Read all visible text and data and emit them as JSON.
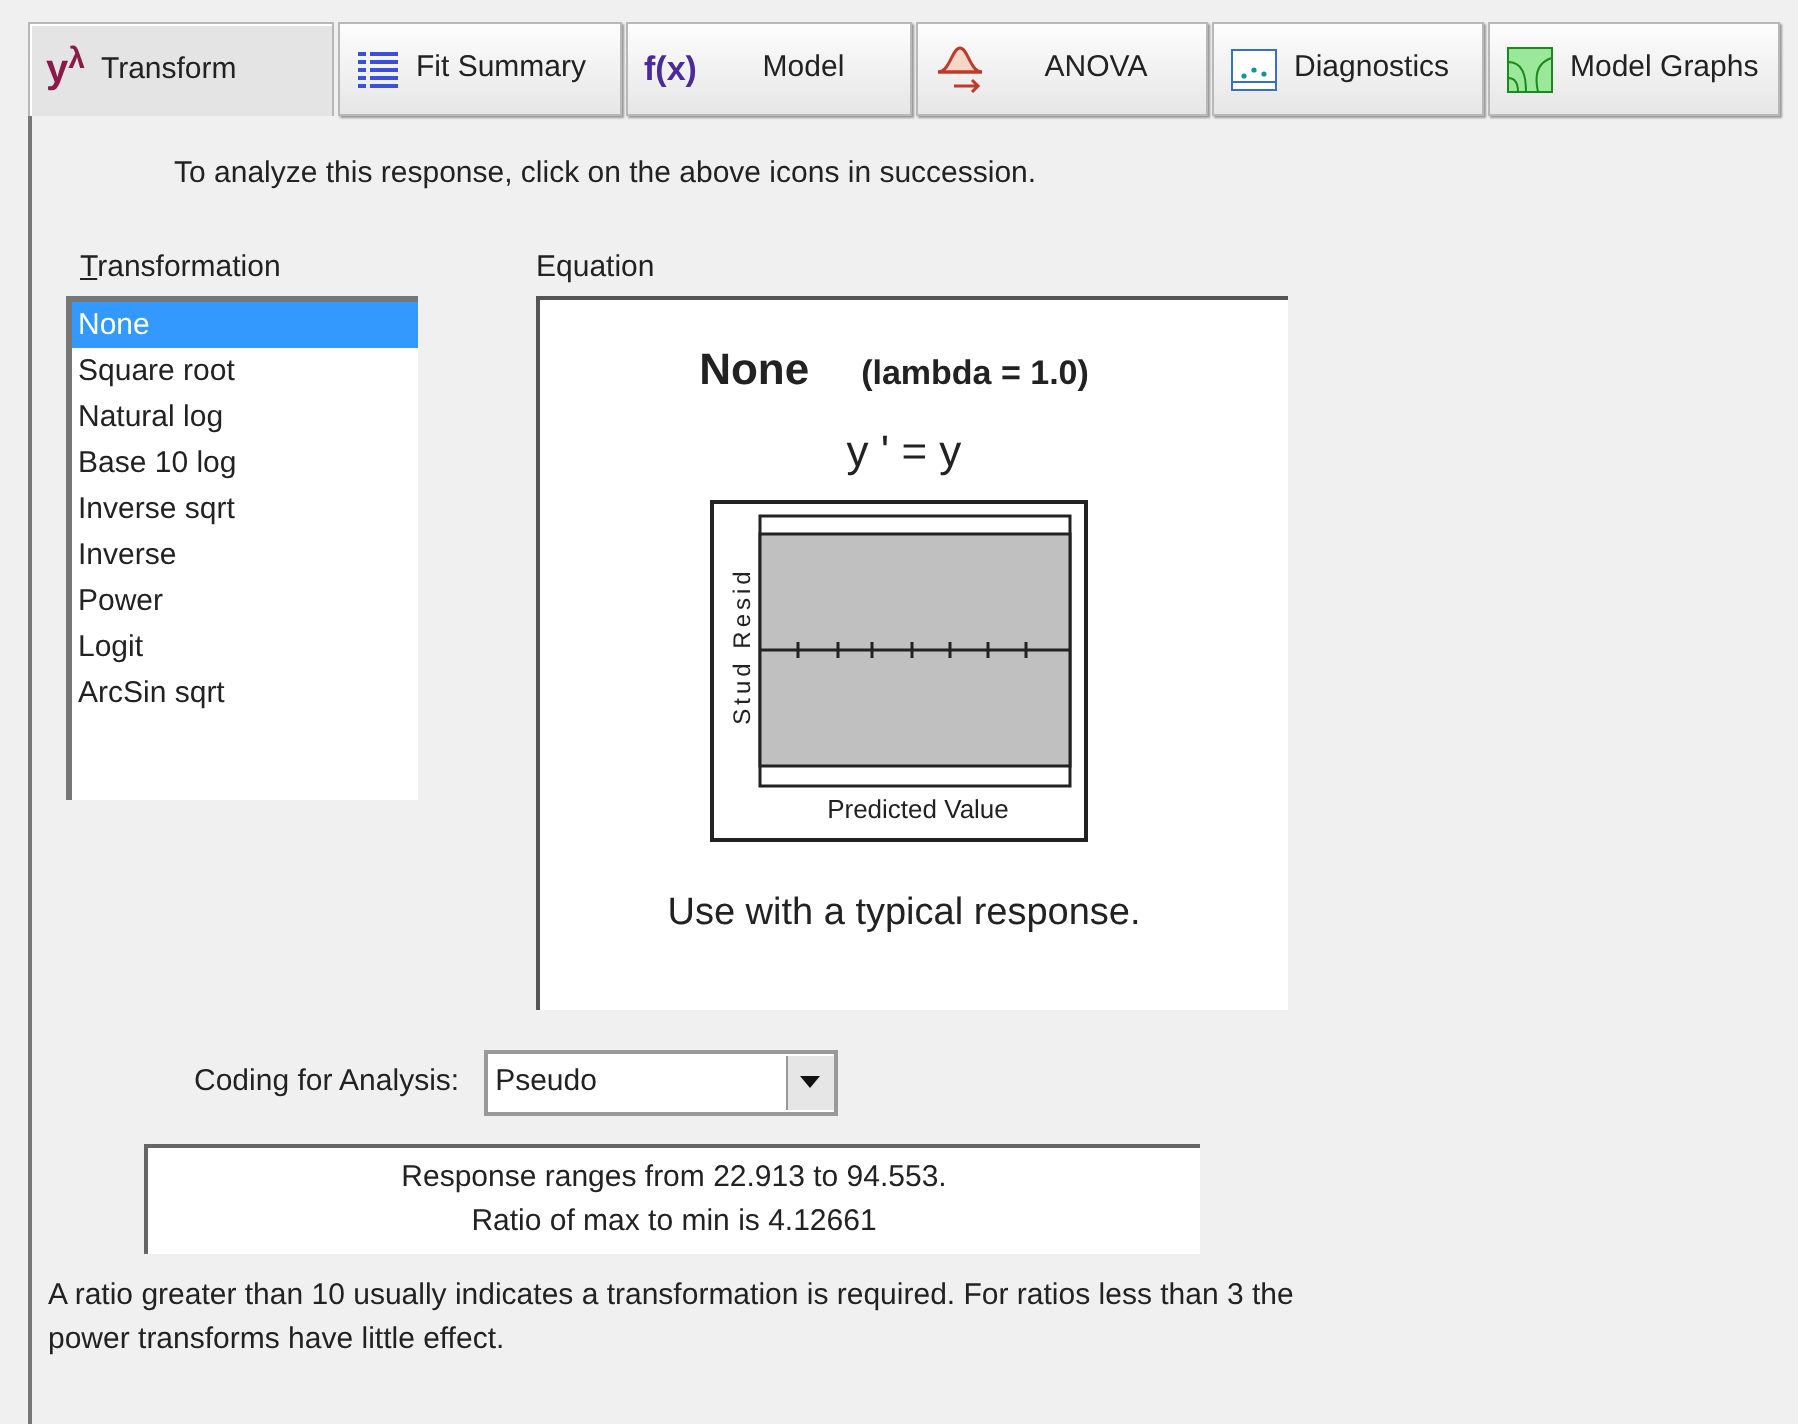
{
  "tabs": [
    {
      "kind": "lambda",
      "icon_text": "y$^{λ}$",
      "label": "Transform",
      "selected": true
    },
    {
      "kind": "table",
      "label": "Fit Summary",
      "selected": false
    },
    {
      "kind": "fx",
      "icon_text": "f(x)",
      "label": "Model",
      "selected": false
    },
    {
      "kind": "curve",
      "label": "ANOVA",
      "selected": false
    },
    {
      "kind": "scatter",
      "label": "Diagnostics",
      "selected": false
    },
    {
      "kind": "contour",
      "label": "Model Graphs",
      "selected": false
    }
  ],
  "instruction": "To analyze this response, click on the above icons in succession.",
  "transformation": {
    "label": "Transformation",
    "items": [
      {
        "label": "None",
        "selected": true
      },
      {
        "label": "Square root",
        "selected": false
      },
      {
        "label": "Natural log",
        "selected": false
      },
      {
        "label": "Base 10 log",
        "selected": false
      },
      {
        "label": "Inverse sqrt",
        "selected": false
      },
      {
        "label": "Inverse",
        "selected": false
      },
      {
        "label": "Power",
        "selected": false
      },
      {
        "label": "Logit",
        "selected": false
      },
      {
        "label": "ArcSin sqrt",
        "selected": false
      }
    ]
  },
  "equation": {
    "label": "Equation",
    "name": "None",
    "lambda": "(lambda = 1.0)",
    "formula": "y ' = y",
    "plot": {
      "ylabel": "Stud Resid",
      "xlabel": "Predicted Value"
    },
    "note": "Use with a typical response."
  },
  "coding": {
    "label": "Coding for Analysis:",
    "value": "Pseudo"
  },
  "response_info": [
    "Response ranges from 22.913 to 94.553.",
    "Ratio of max to min is 4.12661"
  ],
  "footer": "A ratio greater than 10 usually indicates a transformation is required.  For ratios less than 3 the power transforms have little effect."
}
